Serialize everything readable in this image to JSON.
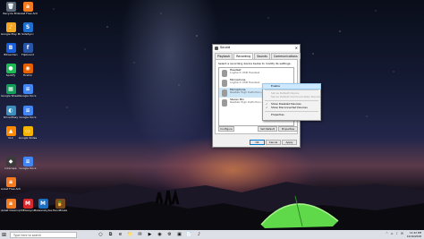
{
  "desktop": {
    "icons": [
      {
        "label": "Recycle Bin",
        "glyph": "🗑",
        "color": "#5d6a7a"
      },
      {
        "label": "Avast Free Antivirus",
        "glyph": "a",
        "color": "#f47a20"
      },
      {
        "label": "Google Play Music Desktop",
        "glyph": "♪",
        "color": "#f5a623"
      },
      {
        "label": "SideSync",
        "glyph": "S",
        "color": "#1f6fd1"
      },
      {
        "label": "Bitwarden",
        "glyph": "B",
        "color": "#175ddc"
      },
      {
        "label": "Flipboard",
        "glyph": "f",
        "color": "#2855a5"
      },
      {
        "label": "Spotify",
        "glyph": "●",
        "color": "#1db954"
      },
      {
        "label": "Firefox",
        "glyph": "◉",
        "color": "#e66000"
      },
      {
        "label": "Google Sheets",
        "glyph": "▦",
        "color": "#0f9d58"
      },
      {
        "label": "Google Docs",
        "glyph": "≡",
        "color": "#4285f4"
      },
      {
        "label": "DriverEasy",
        "glyph": "◐",
        "color": "#3c8dbc"
      },
      {
        "label": "Google Docs",
        "glyph": "≡",
        "color": "#4285f4"
      },
      {
        "label": "VLC",
        "glyph": "▲",
        "color": "#ff8800"
      },
      {
        "label": "Google Slides",
        "glyph": "▭",
        "color": "#f4b400"
      },
      {
        "label": "Inkscape",
        "glyph": "◆",
        "color": "#3b3b3b"
      },
      {
        "label": "Google Docs",
        "glyph": "≡",
        "color": "#4285f4"
      },
      {
        "label": "Avast Free Antivirus",
        "glyph": "a",
        "color": "#f47a20"
      },
      {
        "label": "Avast Cleanup",
        "glyph": "a",
        "color": "#f47a20"
      },
      {
        "label": "MEGAsync",
        "glyph": "M",
        "color": "#d9272e"
      },
      {
        "label": "Malwarebytes",
        "glyph": "M",
        "color": "#1b6ec2"
      },
      {
        "label": "HandBrake",
        "glyph": "🍍",
        "color": "#7a4a1f"
      },
      {
        "label": "Avast Cleanup",
        "glyph": "a",
        "color": "#f47a20"
      }
    ]
  },
  "sound_dialog": {
    "title": "Sound",
    "close_glyph": "✕",
    "tabs": [
      "Playback",
      "Recording",
      "Sounds",
      "Communications"
    ],
    "active_tab": "Recording",
    "instruction": "Select a recording device below to modify its settings:",
    "devices": [
      {
        "name": "Headset",
        "sub": "Logitech USB Headset"
      },
      {
        "name": "Microphone",
        "sub": "Logitech USB Headset"
      },
      {
        "name": "Microphone",
        "sub": "Realtek High Definition Audio"
      },
      {
        "name": "Stereo Mix",
        "sub": "Realtek High Definition Audio"
      }
    ],
    "buttons": {
      "configure": "Configure",
      "set_default": "Set Default",
      "properties": "Properties",
      "ok": "OK",
      "cancel": "Cancel",
      "apply": "Apply"
    }
  },
  "context_menu": {
    "items": [
      {
        "label": "Enable",
        "state": "highlighted"
      },
      {
        "label": "Set as Default Device",
        "state": "disabled"
      },
      {
        "label": "Set as Default Communication Device",
        "state": "disabled"
      },
      {
        "label": "Show Disabled Devices",
        "state": "checked"
      },
      {
        "label": "Show Disconnected Devices",
        "state": "checked"
      },
      {
        "label": "Properties",
        "state": "normal"
      }
    ],
    "check_glyph": "✓"
  },
  "taskbar": {
    "start_glyph": "⊞",
    "search_placeholder": "Type here to search",
    "apps": [
      "○",
      "⧉",
      "e",
      "📁",
      "✉",
      "▶",
      "◉",
      "⚙",
      "▣",
      "📄",
      "♪"
    ],
    "tray_icons": "^ ⌂ ♪ ✉",
    "time": "11:22 PM",
    "date": "10/16/2018"
  },
  "colors": {
    "highlight": "#cce8ff",
    "taskbar": "#dcdfe6",
    "tent": "#5fd84a"
  }
}
